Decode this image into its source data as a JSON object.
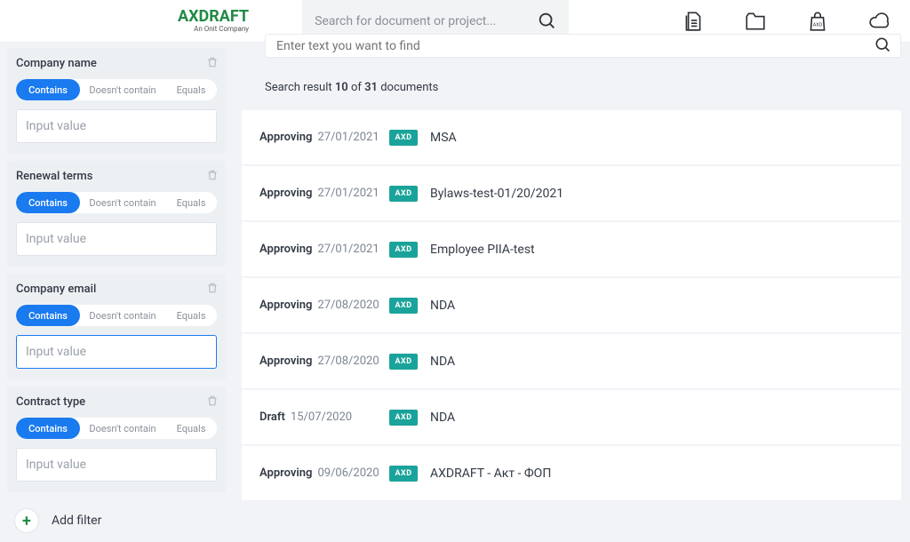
{
  "brand": {
    "name": "AXDRAFT",
    "sub": "An Onit Company"
  },
  "header": {
    "search_placeholder": "Search for document or project..."
  },
  "sidebar": {
    "pill_labels": {
      "contains": "Contains",
      "not_contains": "Doesn't contain",
      "equals": "Equals"
    },
    "input_placeholder": "Input value",
    "filters": [
      {
        "title": "Company name"
      },
      {
        "title": "Renewal terms"
      },
      {
        "title": "Company email"
      },
      {
        "title": "Contract type"
      }
    ],
    "add_filter": "Add filter"
  },
  "main": {
    "search_placeholder": "Enter text you want to find",
    "results_prefix": "Search result ",
    "results_shown": "10",
    "results_mid": " of ",
    "results_total": "31",
    "results_suffix": " documents",
    "badge_text": "AXD",
    "docs": [
      {
        "status": "Approving",
        "date": "27/01/2021",
        "title": "MSA"
      },
      {
        "status": "Approving",
        "date": "27/01/2021",
        "title": "Bylaws-test-01/20/2021"
      },
      {
        "status": "Approving",
        "date": "27/01/2021",
        "title": "Employee PIIA-test"
      },
      {
        "status": "Approving",
        "date": "27/08/2020",
        "title": "NDA"
      },
      {
        "status": "Approving",
        "date": "27/08/2020",
        "title": "NDA"
      },
      {
        "status": "Draft",
        "date": "15/07/2020",
        "title": "NDA"
      },
      {
        "status": "Approving",
        "date": "09/06/2020",
        "title": "AXDRAFT - Акт - ФОП"
      }
    ]
  }
}
